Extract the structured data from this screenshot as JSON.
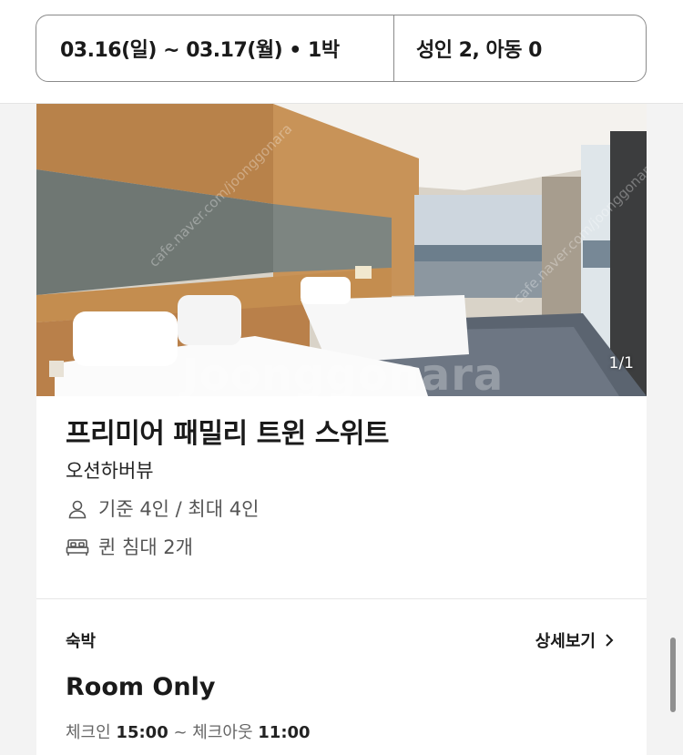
{
  "search": {
    "date_range": "03.16(일) ~ 03.17(월) • 1박",
    "guests": "성인 2, 아동 0"
  },
  "room": {
    "photo_counter": "1/1",
    "watermark": "Joonggonara",
    "watermark_url": "cafe.naver.com/joonggonara",
    "name": "프리미어 패밀리 트윈 스위트",
    "view": "오션하버뷰",
    "capacity": "기준 4인 / 최대 4인",
    "bed": "퀸 침대 2개",
    "icons": {
      "capacity": "person-icon",
      "bed": "bed-icon"
    }
  },
  "plan": {
    "label": "숙박",
    "detail_link": "상세보기",
    "name": "Room Only",
    "checkin_label": "체크인",
    "checkin_time": "15:00",
    "separator": "~",
    "checkout_label": "체크아웃",
    "checkout_time": "11:00"
  }
}
